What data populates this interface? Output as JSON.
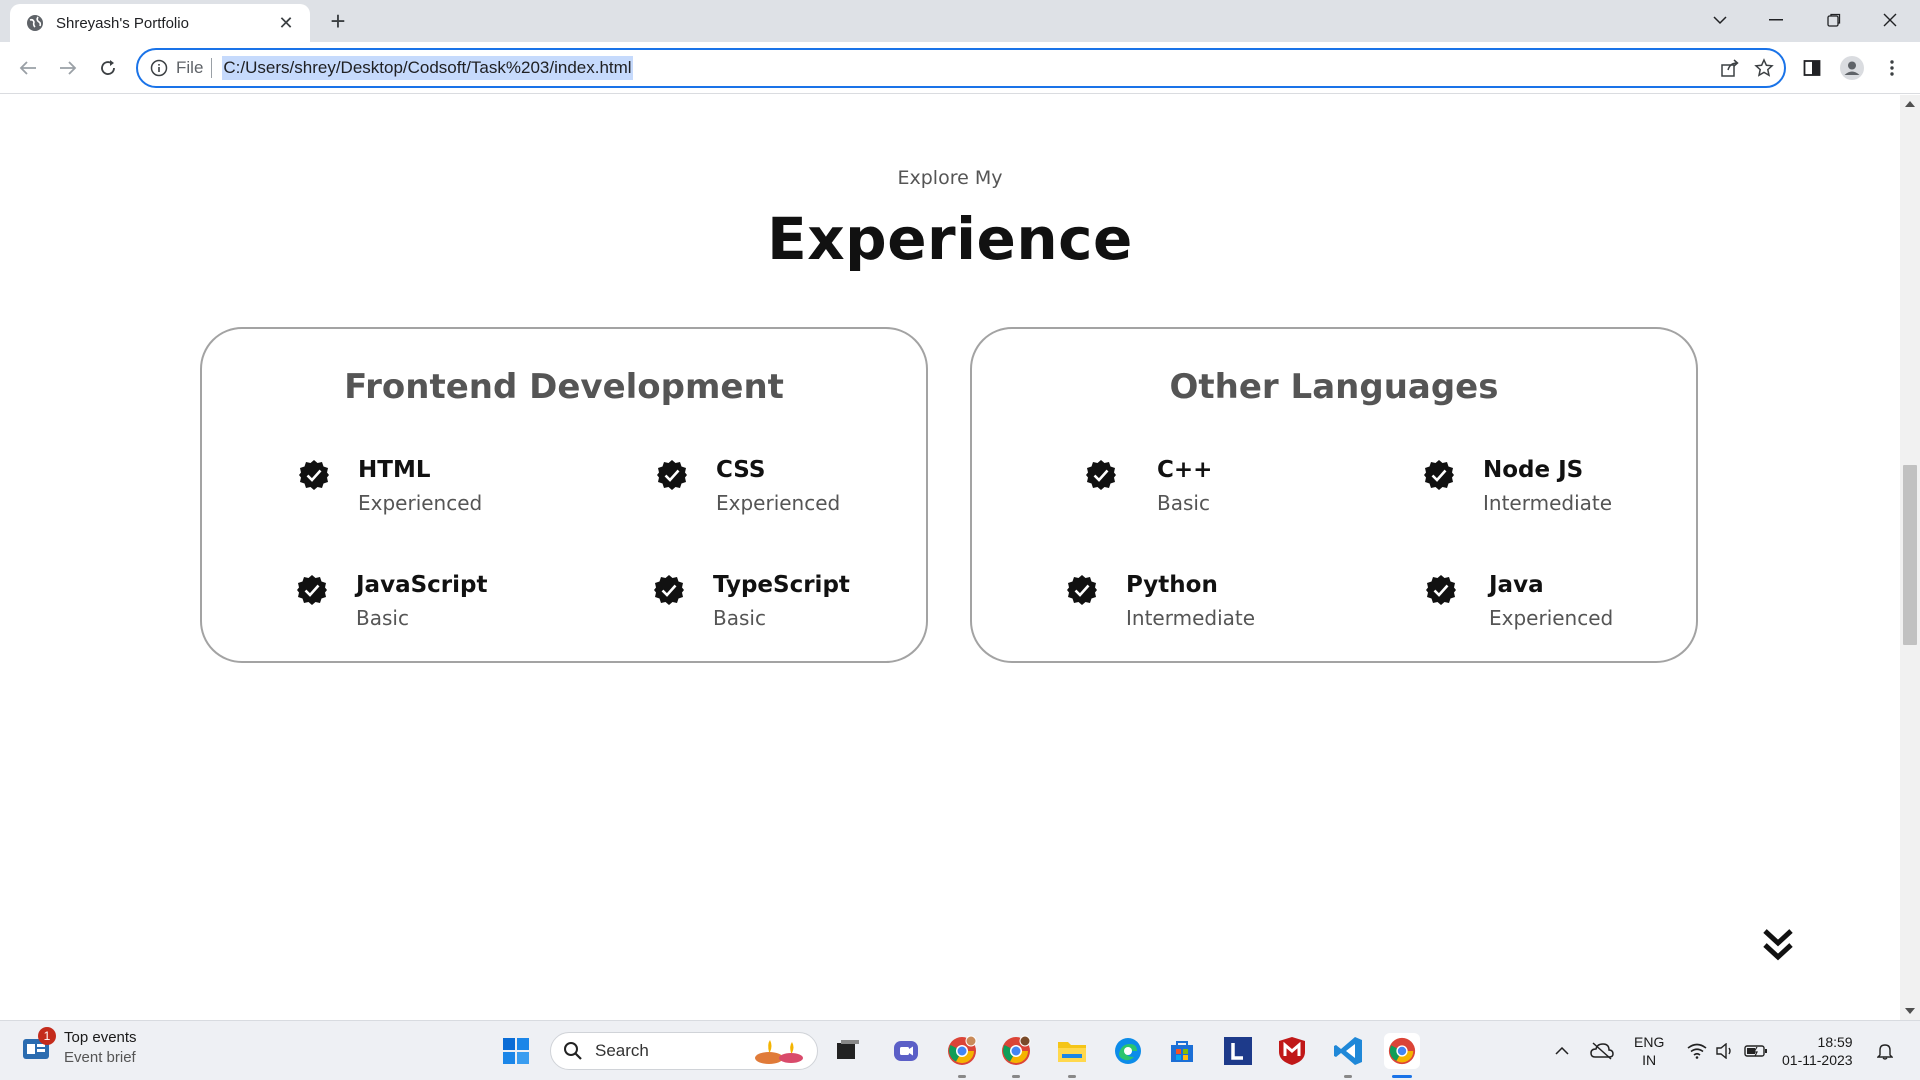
{
  "browser": {
    "tab_title": "Shreyash's Portfolio",
    "new_tab_label": "+",
    "address_scheme": "File",
    "address_url": "C:/Users/shrey/Desktop/Codsoft/Task%203/index.html"
  },
  "page": {
    "subtitle": "Explore My",
    "title": "Experience",
    "cards": [
      {
        "title": "Frontend Development",
        "skills": [
          {
            "name": "HTML",
            "level": "Experienced"
          },
          {
            "name": "CSS",
            "level": "Experienced"
          },
          {
            "name": "JavaScript",
            "level": "Basic"
          },
          {
            "name": "TypeScript",
            "level": "Basic"
          }
        ]
      },
      {
        "title": "Other Languages",
        "skills": [
          {
            "name": "C++",
            "level": "Basic"
          },
          {
            "name": "Node JS",
            "level": "Intermediate"
          },
          {
            "name": "Python",
            "level": "Intermediate"
          },
          {
            "name": "Java",
            "level": "Experienced"
          }
        ]
      }
    ],
    "scroll_icon": "double-chevron-down-icon"
  },
  "taskbar": {
    "weather_title": "Top events",
    "weather_sub": "Event brief",
    "weather_badge": "1",
    "search_placeholder": "Search",
    "lang_line1": "ENG",
    "lang_line2": "IN",
    "time": "18:59",
    "date": "01-11-2023"
  },
  "colors": {
    "accent": "#1a73e8",
    "card_border": "#a3a3a3",
    "heading": "#111111",
    "muted": "#555555"
  }
}
